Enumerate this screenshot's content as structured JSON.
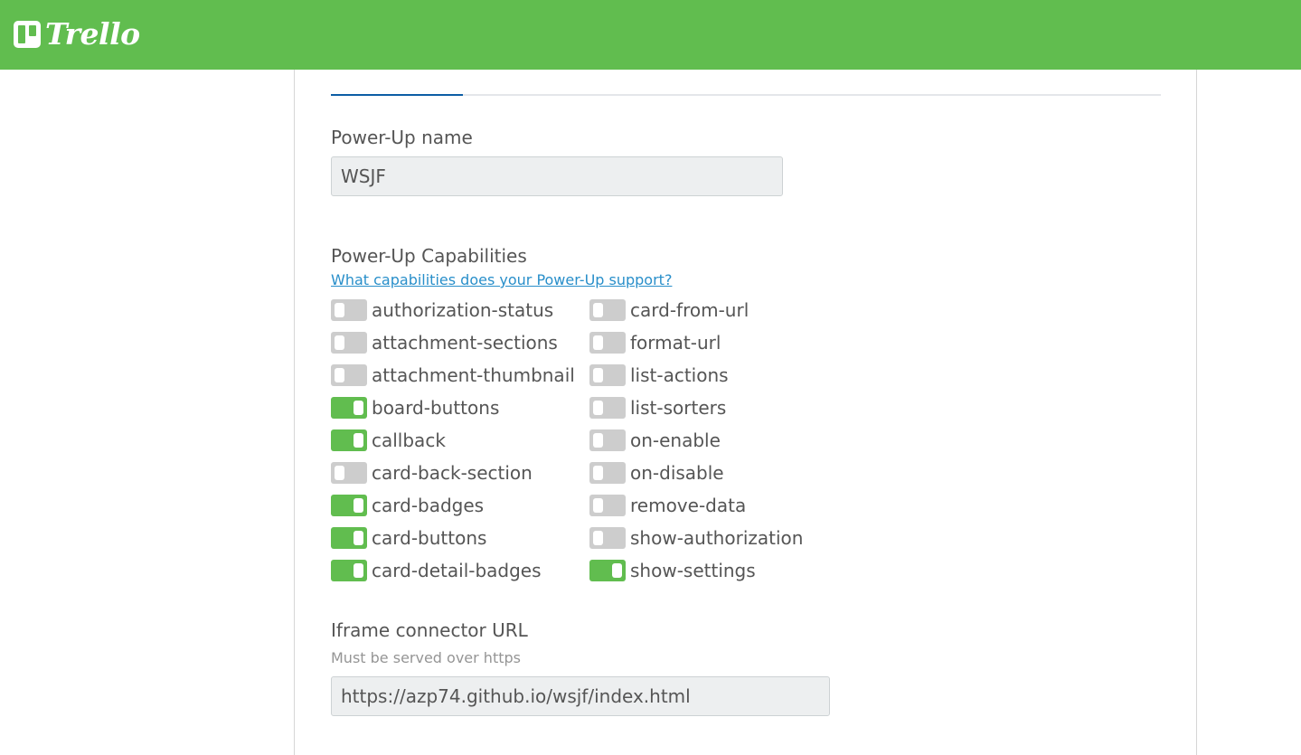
{
  "app": {
    "name": "Trello",
    "brand_color": "#61bd4f",
    "logo_icon": "trello-board-icon"
  },
  "form": {
    "name_label": "Power-Up name",
    "name_value": "WSJF",
    "capabilities_label": "Power-Up Capabilities",
    "capabilities_help_link": "What capabilities does your Power-Up support?",
    "capabilities_left": [
      {
        "label": "authorization-status",
        "enabled": false
      },
      {
        "label": "attachment-sections",
        "enabled": false
      },
      {
        "label": "attachment-thumbnail",
        "enabled": false
      },
      {
        "label": "board-buttons",
        "enabled": true
      },
      {
        "label": "callback",
        "enabled": true
      },
      {
        "label": "card-back-section",
        "enabled": false
      },
      {
        "label": "card-badges",
        "enabled": true
      },
      {
        "label": "card-buttons",
        "enabled": true
      },
      {
        "label": "card-detail-badges",
        "enabled": true
      }
    ],
    "capabilities_right": [
      {
        "label": "card-from-url",
        "enabled": false
      },
      {
        "label": "format-url",
        "enabled": false
      },
      {
        "label": "list-actions",
        "enabled": false
      },
      {
        "label": "list-sorters",
        "enabled": false
      },
      {
        "label": "on-enable",
        "enabled": false
      },
      {
        "label": "on-disable",
        "enabled": false
      },
      {
        "label": "remove-data",
        "enabled": false
      },
      {
        "label": "show-authorization",
        "enabled": false
      },
      {
        "label": "show-settings",
        "enabled": true
      }
    ],
    "iframe_label": "Iframe connector URL",
    "iframe_hint": "Must be served over https",
    "iframe_value": "https://azp74.github.io/wsjf/index.html"
  },
  "colors": {
    "toggle_on": "#61bd4f",
    "toggle_off": "#cdcdcd",
    "active_tab": "#0c5da5",
    "link": "#298fca"
  }
}
